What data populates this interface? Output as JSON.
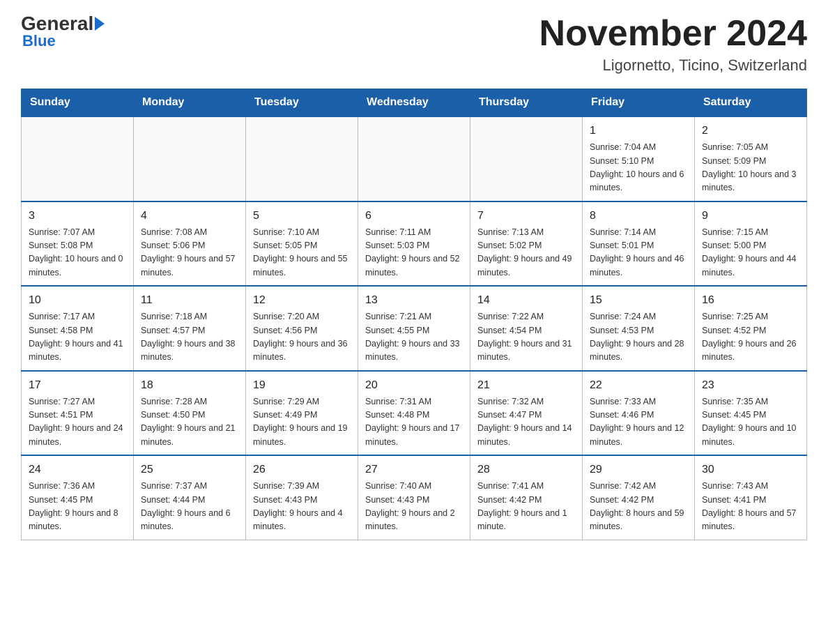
{
  "header": {
    "logo_text_general": "General",
    "logo_text_blue": "Blue",
    "month_title": "November 2024",
    "location": "Ligornetto, Ticino, Switzerland"
  },
  "days_of_week": [
    "Sunday",
    "Monday",
    "Tuesday",
    "Wednesday",
    "Thursday",
    "Friday",
    "Saturday"
  ],
  "weeks": [
    {
      "days": [
        {
          "date": "",
          "info": ""
        },
        {
          "date": "",
          "info": ""
        },
        {
          "date": "",
          "info": ""
        },
        {
          "date": "",
          "info": ""
        },
        {
          "date": "",
          "info": ""
        },
        {
          "date": "1",
          "info": "Sunrise: 7:04 AM\nSunset: 5:10 PM\nDaylight: 10 hours and 6 minutes."
        },
        {
          "date": "2",
          "info": "Sunrise: 7:05 AM\nSunset: 5:09 PM\nDaylight: 10 hours and 3 minutes."
        }
      ]
    },
    {
      "days": [
        {
          "date": "3",
          "info": "Sunrise: 7:07 AM\nSunset: 5:08 PM\nDaylight: 10 hours and 0 minutes."
        },
        {
          "date": "4",
          "info": "Sunrise: 7:08 AM\nSunset: 5:06 PM\nDaylight: 9 hours and 57 minutes."
        },
        {
          "date": "5",
          "info": "Sunrise: 7:10 AM\nSunset: 5:05 PM\nDaylight: 9 hours and 55 minutes."
        },
        {
          "date": "6",
          "info": "Sunrise: 7:11 AM\nSunset: 5:03 PM\nDaylight: 9 hours and 52 minutes."
        },
        {
          "date": "7",
          "info": "Sunrise: 7:13 AM\nSunset: 5:02 PM\nDaylight: 9 hours and 49 minutes."
        },
        {
          "date": "8",
          "info": "Sunrise: 7:14 AM\nSunset: 5:01 PM\nDaylight: 9 hours and 46 minutes."
        },
        {
          "date": "9",
          "info": "Sunrise: 7:15 AM\nSunset: 5:00 PM\nDaylight: 9 hours and 44 minutes."
        }
      ]
    },
    {
      "days": [
        {
          "date": "10",
          "info": "Sunrise: 7:17 AM\nSunset: 4:58 PM\nDaylight: 9 hours and 41 minutes."
        },
        {
          "date": "11",
          "info": "Sunrise: 7:18 AM\nSunset: 4:57 PM\nDaylight: 9 hours and 38 minutes."
        },
        {
          "date": "12",
          "info": "Sunrise: 7:20 AM\nSunset: 4:56 PM\nDaylight: 9 hours and 36 minutes."
        },
        {
          "date": "13",
          "info": "Sunrise: 7:21 AM\nSunset: 4:55 PM\nDaylight: 9 hours and 33 minutes."
        },
        {
          "date": "14",
          "info": "Sunrise: 7:22 AM\nSunset: 4:54 PM\nDaylight: 9 hours and 31 minutes."
        },
        {
          "date": "15",
          "info": "Sunrise: 7:24 AM\nSunset: 4:53 PM\nDaylight: 9 hours and 28 minutes."
        },
        {
          "date": "16",
          "info": "Sunrise: 7:25 AM\nSunset: 4:52 PM\nDaylight: 9 hours and 26 minutes."
        }
      ]
    },
    {
      "days": [
        {
          "date": "17",
          "info": "Sunrise: 7:27 AM\nSunset: 4:51 PM\nDaylight: 9 hours and 24 minutes."
        },
        {
          "date": "18",
          "info": "Sunrise: 7:28 AM\nSunset: 4:50 PM\nDaylight: 9 hours and 21 minutes."
        },
        {
          "date": "19",
          "info": "Sunrise: 7:29 AM\nSunset: 4:49 PM\nDaylight: 9 hours and 19 minutes."
        },
        {
          "date": "20",
          "info": "Sunrise: 7:31 AM\nSunset: 4:48 PM\nDaylight: 9 hours and 17 minutes."
        },
        {
          "date": "21",
          "info": "Sunrise: 7:32 AM\nSunset: 4:47 PM\nDaylight: 9 hours and 14 minutes."
        },
        {
          "date": "22",
          "info": "Sunrise: 7:33 AM\nSunset: 4:46 PM\nDaylight: 9 hours and 12 minutes."
        },
        {
          "date": "23",
          "info": "Sunrise: 7:35 AM\nSunset: 4:45 PM\nDaylight: 9 hours and 10 minutes."
        }
      ]
    },
    {
      "days": [
        {
          "date": "24",
          "info": "Sunrise: 7:36 AM\nSunset: 4:45 PM\nDaylight: 9 hours and 8 minutes."
        },
        {
          "date": "25",
          "info": "Sunrise: 7:37 AM\nSunset: 4:44 PM\nDaylight: 9 hours and 6 minutes."
        },
        {
          "date": "26",
          "info": "Sunrise: 7:39 AM\nSunset: 4:43 PM\nDaylight: 9 hours and 4 minutes."
        },
        {
          "date": "27",
          "info": "Sunrise: 7:40 AM\nSunset: 4:43 PM\nDaylight: 9 hours and 2 minutes."
        },
        {
          "date": "28",
          "info": "Sunrise: 7:41 AM\nSunset: 4:42 PM\nDaylight: 9 hours and 1 minute."
        },
        {
          "date": "29",
          "info": "Sunrise: 7:42 AM\nSunset: 4:42 PM\nDaylight: 8 hours and 59 minutes."
        },
        {
          "date": "30",
          "info": "Sunrise: 7:43 AM\nSunset: 4:41 PM\nDaylight: 8 hours and 57 minutes."
        }
      ]
    }
  ]
}
